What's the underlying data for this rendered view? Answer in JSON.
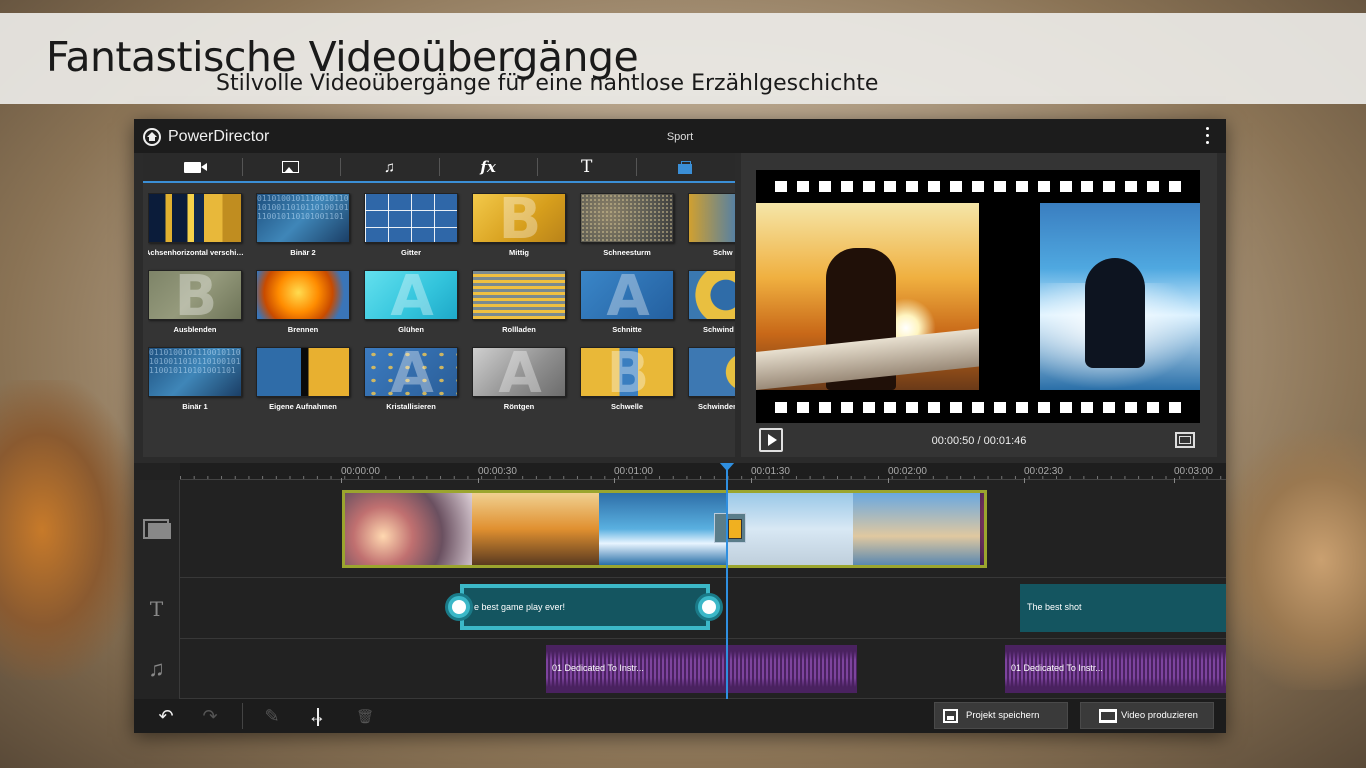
{
  "banner": {
    "title": "Fantastische Videoübergänge",
    "subtitle": "Stilvolle Videoübergänge für eine nahtlose Erzählgeschichte"
  },
  "app": {
    "name": "PowerDirector",
    "project_name": "Sport",
    "menu_icon": "more-vertical-icon"
  },
  "library": {
    "tabs": [
      {
        "icon": "video-icon",
        "label": ""
      },
      {
        "icon": "image-icon",
        "label": ""
      },
      {
        "icon": "music-icon",
        "label": "♫"
      },
      {
        "icon": "fx-icon",
        "label": "fx"
      },
      {
        "icon": "text-icon",
        "label": "T"
      },
      {
        "icon": "transition-icon",
        "label": "",
        "active": true
      }
    ],
    "transitions": [
      {
        "label": "Achsenhorizontal verschie…"
      },
      {
        "label": "Binär 2"
      },
      {
        "label": "Gitter"
      },
      {
        "label": "Mittig",
        "letter": "B"
      },
      {
        "label": "Schneesturm"
      },
      {
        "label": "Schw"
      },
      {
        "label": "Ausblenden",
        "letter": "B"
      },
      {
        "label": "Brennen"
      },
      {
        "label": "Glühen",
        "letter": "A"
      },
      {
        "label": "Rollladen"
      },
      {
        "label": "Schnitte",
        "letter": "A"
      },
      {
        "label": "Schwind"
      },
      {
        "label": "Binär 1"
      },
      {
        "label": "Eigene Aufnahmen"
      },
      {
        "label": "Kristallisieren",
        "letter": "A"
      },
      {
        "label": "Röntgen",
        "letter": "A"
      },
      {
        "label": "Schwelle",
        "letter": "B"
      },
      {
        "label": "Schwinden -"
      }
    ],
    "binary_digits": "01101001011100101101010011010110100101110010110101001101"
  },
  "preview": {
    "timecode": "00:00:50 / 00:01:46",
    "play_icon": "play-icon",
    "fullscreen_icon": "fullscreen-icon"
  },
  "timeline": {
    "ruler_ticks": [
      "00:00:00",
      "00:00:30",
      "00:01:00",
      "00:01:30",
      "00:02:00",
      "00:02:30",
      "00:03:00"
    ],
    "tracks": [
      {
        "icon": "image-track-icon"
      },
      {
        "icon": "text-track-icon",
        "glyph": "T"
      },
      {
        "icon": "music-track-icon",
        "glyph": "♫"
      }
    ],
    "title_clips": [
      "e best game play ever!",
      "The best shot"
    ],
    "audio_clips": [
      "01 Dedicated To Instr...",
      "01 Dedicated To Instr..."
    ]
  },
  "toolbar": {
    "undo": "↶",
    "redo": "↷",
    "edit": "✎",
    "delete": "🗑",
    "save_label": "Projekt speichern",
    "produce_label": "Video produzieren"
  },
  "colors": {
    "accent": "#3b8fd6",
    "playhead": "#2f8fe0",
    "title_clip": "#3cb8c8",
    "audio_clip": "#4a2260",
    "video_clip_border": "#9ba52e"
  }
}
